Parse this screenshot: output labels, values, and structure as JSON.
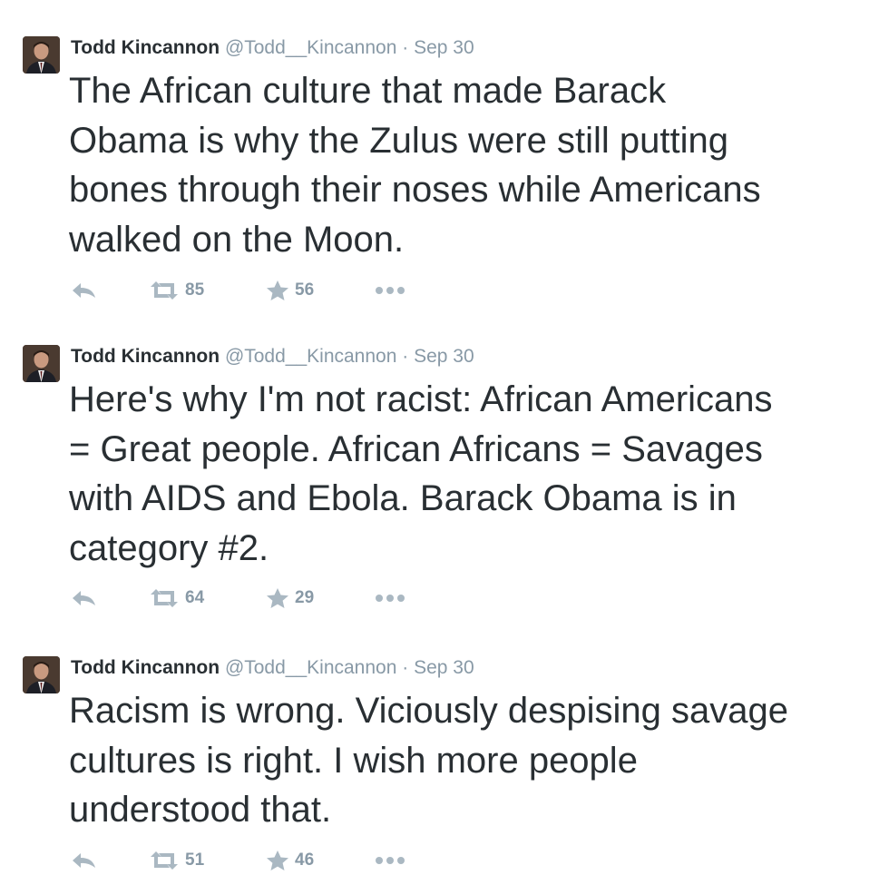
{
  "tweets": [
    {
      "fullname": "Todd Kincannon",
      "username": "@Todd__Kincannon",
      "separator": "·",
      "time": "Sep 30",
      "lines": [
        "The African culture that made Barack",
        "Obama is why the Zulus were still putting",
        "bones through their noses while Americans",
        "walked on the Moon."
      ],
      "retweets": "85",
      "favorites": "56"
    },
    {
      "fullname": "Todd Kincannon",
      "username": "@Todd__Kincannon",
      "separator": "·",
      "time": "Sep 30",
      "lines": [
        "Here's why I'm not racist: African Americans",
        "= Great people. African Africans = Savages",
        "with AIDS and Ebola. Barack Obama is in",
        "category #2."
      ],
      "retweets": "64",
      "favorites": "29"
    },
    {
      "fullname": "Todd Kincannon",
      "username": "@Todd__Kincannon",
      "separator": "·",
      "time": "Sep 30",
      "lines": [
        "Racism is wrong. Viciously despising savage",
        "cultures is right. I wish more people",
        "understood that."
      ],
      "retweets": "51",
      "favorites": "46"
    }
  ],
  "icons": {
    "reply": "reply-icon",
    "retweet": "retweet-icon",
    "favorite": "star-icon",
    "more": "more-icon"
  },
  "colors": {
    "text": "#292f33",
    "muted": "#8899a6",
    "icon": "#aab8c2"
  }
}
